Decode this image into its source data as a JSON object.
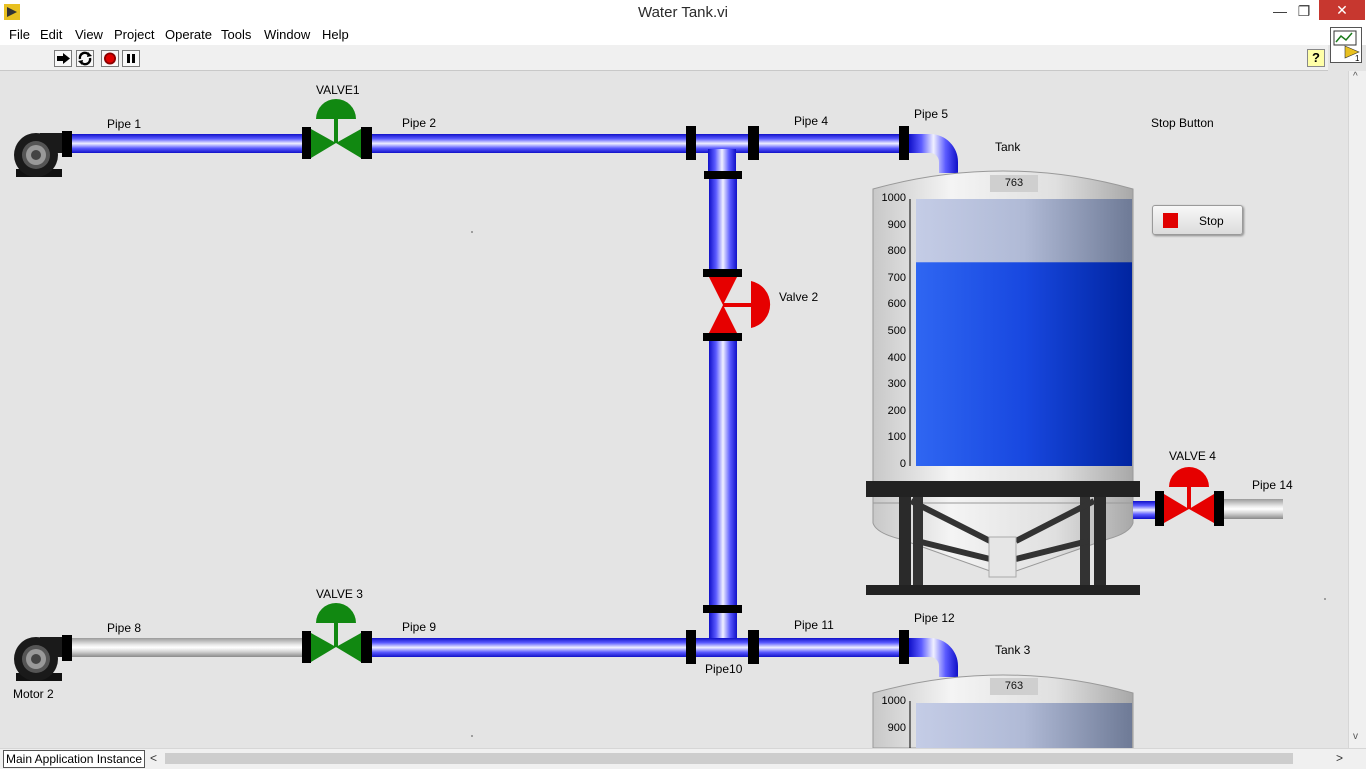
{
  "window": {
    "title": "Water Tank.vi",
    "minimize_glyph": "—",
    "restore_glyph": "❐",
    "close_glyph": "✕"
  },
  "menu": [
    "File",
    "Edit",
    "View",
    "Project",
    "Operate",
    "Tools",
    "Window",
    "Help"
  ],
  "toolbar": {
    "buttons": [
      "run-arrow-icon",
      "run-continuously-icon",
      "abort-icon",
      "pause-icon"
    ],
    "help_label": "?"
  },
  "vi_icon": {
    "number": "1"
  },
  "labels": {
    "pipe1": "Pipe 1",
    "valve1": "VALVE1",
    "pipe2": "Pipe 2",
    "pipe4": "Pipe 4",
    "pipe5": "Pipe 5",
    "tank": "Tank",
    "stop_button": "Stop Button",
    "valve2": "Valve 2",
    "valve4": "VALVE 4",
    "pipe14": "Pipe 14",
    "pipe8": "Pipe 8",
    "valve3": "VALVE 3",
    "pipe9": "Pipe 9",
    "pipe11": "Pipe 11",
    "pipe12": "Pipe 12",
    "pipe10": "Pipe10",
    "tank3": "Tank 3",
    "motor2": "Motor 2"
  },
  "stop_button": {
    "label": "Stop"
  },
  "tank": {
    "value": "763",
    "level": 763,
    "scale_max": 1000,
    "ticks": [
      "1000",
      "900",
      "800",
      "700",
      "600",
      "500",
      "400",
      "300",
      "200",
      "100",
      "0"
    ]
  },
  "tank3": {
    "value": "763",
    "ticks": [
      "1000",
      "900"
    ]
  },
  "valves": {
    "valve1": {
      "state": "open",
      "color": "#118811"
    },
    "valve2": {
      "state": "closed",
      "color": "#e60000"
    },
    "valve3": {
      "state": "open",
      "color": "#118811"
    },
    "valve4": {
      "state": "closed",
      "color": "#e60000"
    }
  },
  "colors": {
    "water_pipe": "#2a2ae0",
    "empty_pipe": "#d8d8d8",
    "water": "#1244d8"
  },
  "status": {
    "instance": "Main Application Instance",
    "scroll_left": "<",
    "scroll_right": ">",
    "scroll_up": "^",
    "scroll_down": "v"
  }
}
